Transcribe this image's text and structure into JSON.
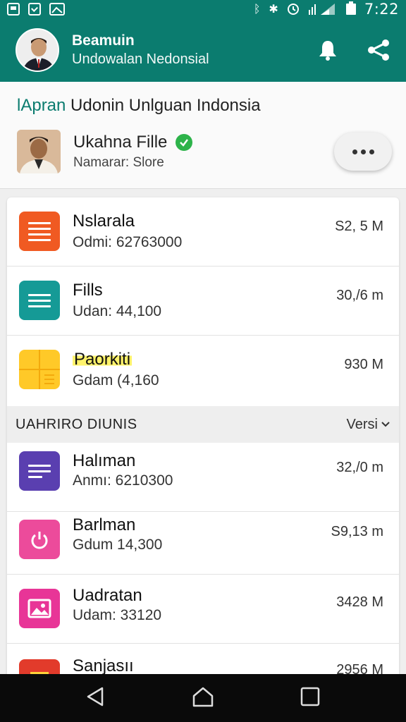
{
  "status_bar": {
    "icons": [
      "image-icon",
      "check-box-icon",
      "cloud-icon"
    ],
    "right_icons": [
      "bluetooth-icon",
      "vibrate-icon",
      "alarm-icon",
      "signal-icon",
      "battery-icon"
    ],
    "time": "7:22"
  },
  "app_bar": {
    "title": "Beamuin",
    "subtitle": "Undowalan Nedonsial",
    "actions": [
      "bell-icon",
      "share-icon"
    ]
  },
  "top_card": {
    "title_accent": "lApran",
    "title_rest": " Udonin Unlguan Indonsia",
    "owner_name": "Ukahna Fille",
    "owner_sub": "Namarar: Slore"
  },
  "files": [
    {
      "title": "Nslarala",
      "sub": "Odmi: 62763000",
      "size": "S2, 5 M",
      "icon": "document-orange-icon",
      "color": "#f05a22"
    },
    {
      "title": "Fills",
      "sub": "Udan: 44,100",
      "size": "30,/6 m",
      "icon": "document-teal-icon",
      "color": "#159a96"
    },
    {
      "title": "Paorkiti",
      "sub": "Gdam (4,160",
      "size": "930 M",
      "icon": "table-yellow-icon",
      "color": "#ffc928"
    }
  ],
  "section": {
    "label": "UAHRIRO DIUNIS",
    "sort_label": "Versi"
  },
  "apps": [
    {
      "title": "Halıman",
      "sub": "Anmı: 6210300",
      "size": "32,/0 m",
      "icon": "document-purple-icon",
      "color": "#5a3fb0"
    },
    {
      "title": "Barlman",
      "sub": "Gdum 14,300",
      "size": "S9,13 m",
      "icon": "power-pink-icon",
      "color": "#ec4b9b"
    },
    {
      "title": "Uadratan",
      "sub": "Udam: 33120",
      "size": "3428 M",
      "icon": "photo-magenta-icon",
      "color": "#e83597"
    },
    {
      "title": "Sanjasıı",
      "sub": "",
      "size": "2956 M",
      "icon": "video-red-icon",
      "color": "#e23b2b"
    }
  ],
  "nav": [
    "back-icon",
    "home-icon",
    "recents-icon"
  ]
}
